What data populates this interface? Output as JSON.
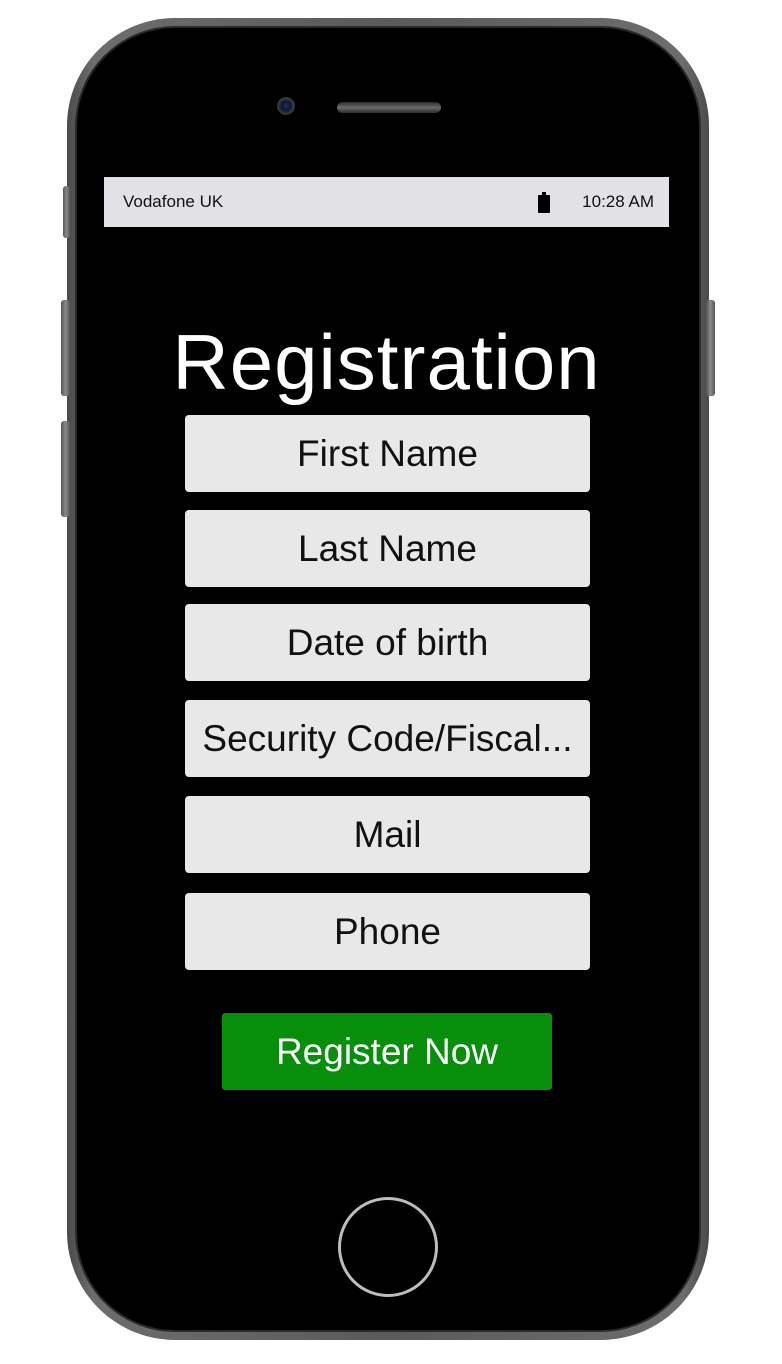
{
  "device": {
    "status_bar": {
      "carrier": "Vodafone UK",
      "battery_icon": "battery-icon",
      "time": "10:28 AM"
    }
  },
  "registration": {
    "title": "Registration",
    "fields": [
      {
        "label": "First Name"
      },
      {
        "label": "Last Name"
      },
      {
        "label": "Date of birth"
      },
      {
        "label": "Security Code/Fiscal..."
      },
      {
        "label": "Mail"
      },
      {
        "label": "Phone"
      }
    ],
    "submit_label": "Register Now"
  },
  "colors": {
    "screen_background": "#000000",
    "field_background": "#e8e8e8",
    "status_bar_background": "#e2e2e6",
    "submit_button": "#078f0c"
  }
}
